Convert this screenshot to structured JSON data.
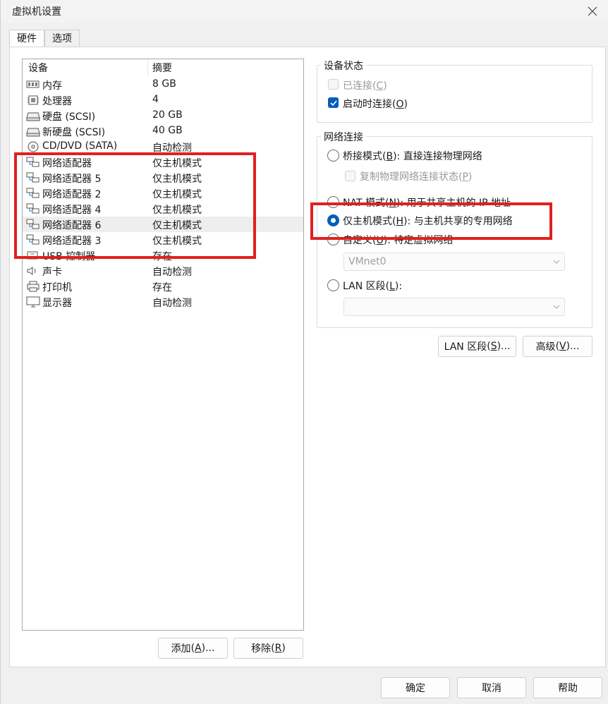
{
  "window": {
    "title": "虚拟机设置"
  },
  "tabs": [
    {
      "label": "硬件"
    },
    {
      "label": "选项"
    }
  ],
  "device_list": {
    "columns": {
      "device": "设备",
      "summary": "摘要"
    },
    "devices": [
      {
        "name": "内存",
        "summary": "8 GB",
        "icon": "memory-icon"
      },
      {
        "name": "处理器",
        "summary": "4",
        "icon": "processor-icon"
      },
      {
        "name": "硬盘 (SCSI)",
        "summary": "20 GB",
        "icon": "hard-disk-icon"
      },
      {
        "name": "新硬盘 (SCSI)",
        "summary": "40 GB",
        "icon": "hard-disk-icon"
      },
      {
        "name": "CD/DVD (SATA)",
        "summary": "自动检测",
        "icon": "cd-dvd-icon"
      },
      {
        "name": "网络适配器",
        "summary": "仅主机模式",
        "icon": "network-adapter-icon"
      },
      {
        "name": "网络适配器 5",
        "summary": "仅主机模式",
        "icon": "network-adapter-icon"
      },
      {
        "name": "网络适配器 2",
        "summary": "仅主机模式",
        "icon": "network-adapter-icon"
      },
      {
        "name": "网络适配器 4",
        "summary": "仅主机模式",
        "icon": "network-adapter-icon"
      },
      {
        "name": "网络适配器 6",
        "summary": "仅主机模式",
        "icon": "network-adapter-icon",
        "selected": true
      },
      {
        "name": "网络适配器 3",
        "summary": "仅主机模式",
        "icon": "network-adapter-icon"
      },
      {
        "name": "USB 控制器",
        "summary": "存在",
        "icon": "usb-icon"
      },
      {
        "name": "声卡",
        "summary": "自动检测",
        "icon": "speaker-icon"
      },
      {
        "name": "打印机",
        "summary": "存在",
        "icon": "printer-icon"
      },
      {
        "name": "显示器",
        "summary": "自动检测",
        "icon": "monitor-icon"
      }
    ],
    "add_button": {
      "label": "添加",
      "mnemonic": "A",
      "suffix": "..."
    },
    "remove_button": {
      "label": "移除",
      "mnemonic": "R",
      "suffix": ""
    }
  },
  "device_status": {
    "title": "设备状态",
    "connected": {
      "label": "已连接",
      "mnemonic": "C",
      "checked": false,
      "disabled": true
    },
    "connect_at_power_on": {
      "label": "启动时连接",
      "mnemonic": "O",
      "checked": true
    }
  },
  "network_connection": {
    "title": "网络连接",
    "bridged": {
      "label": "桥接模式",
      "mnemonic": "B",
      "desc": ": 直接连接物理网络",
      "selected": false
    },
    "replicate": {
      "label": "复制物理网络连接状态",
      "mnemonic": "P",
      "disabled": true
    },
    "nat": {
      "label": "NAT 模式",
      "mnemonic": "N",
      "desc": ": 用于共享主机的 IP 地址",
      "selected": false
    },
    "host_only": {
      "label": "仅主机模式",
      "mnemonic": "H",
      "desc": ": 与主机共享的专用网络",
      "selected": true
    },
    "custom": {
      "label": "自定义",
      "mnemonic": "U",
      "desc": ": 特定虚拟网络",
      "selected": false
    },
    "vmnet_select": {
      "value": "VMnet0"
    },
    "lan_segment": {
      "label": "LAN 区段",
      "mnemonic": "L",
      "suffix": ":",
      "selected": false
    },
    "lan_select": {
      "value": ""
    }
  },
  "buttons": {
    "lan_segments": {
      "label": "LAN 区段",
      "mnemonic": "S",
      "suffix": "..."
    },
    "advanced": {
      "label": "高级",
      "mnemonic": "V",
      "suffix": "..."
    },
    "ok": "确定",
    "cancel": "取消",
    "help": "帮助"
  },
  "colors": {
    "accent": "#005fb8",
    "annotation": "#e02020"
  }
}
